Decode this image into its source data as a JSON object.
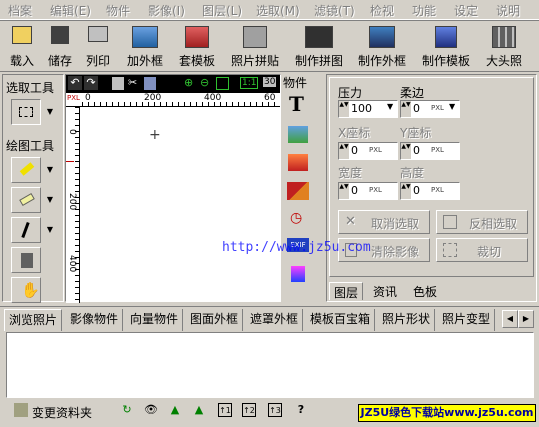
{
  "menu": [
    "档案",
    "编辑(E)",
    "物件",
    "影像(I)",
    "图层(L)",
    "选取(M)",
    "滤镜(T)",
    "检视",
    "功能",
    "设定",
    "说明"
  ],
  "toolbar": {
    "load": "载入",
    "save": "储存",
    "print": "列印",
    "add_frame": "加外框",
    "template": "套模板",
    "photo_collage": "照片拼贴",
    "make_collage": "制作拼图",
    "make_frame": "制作外框",
    "make_template": "制作模板",
    "big_head": "大头照"
  },
  "left": {
    "select_tool": "选取工具",
    "draw_tool": "绘图工具"
  },
  "ruler": {
    "unit": "PXL",
    "h_ticks": [
      "0",
      "200",
      "400",
      "60"
    ],
    "v_ticks": [
      "0",
      "200",
      "400"
    ]
  },
  "canvas_tb": {
    "fit": "1:1",
    "zoom": "30"
  },
  "objects_title": "物件",
  "props": {
    "pressure": "压力",
    "feather": "柔边",
    "pressure_value": "100",
    "feather_value": "0",
    "unit": "PXL",
    "x_label": "X座标",
    "y_label": "Y座标",
    "x_value": "0",
    "y_value": "0",
    "width_label": "宽度",
    "height_label": "高度",
    "width_value": "0",
    "height_value": "0",
    "cancel_sel": "取消选取",
    "invert_sel": "反相选取",
    "clear_img": "清除影像",
    "crop": "裁切"
  },
  "right_tabs": [
    "图层",
    "资讯",
    "色板"
  ],
  "watermark": "http://www.jz5u.com",
  "bottom_tabs": [
    "浏览照片",
    "影像物件",
    "向量物件",
    "图面外框",
    "遮罩外框",
    "模板百宝箱",
    "照片形状",
    "照片变型"
  ],
  "status": {
    "change_folder": "变更资料夹",
    "badge": "JZ5U绿色下载站www.jz5u.com"
  },
  "colors": {
    "bg": "#d4d0c8",
    "badge_bg": "#ffff00",
    "badge_text": "#0000a0",
    "watermark": "#0000ff"
  }
}
